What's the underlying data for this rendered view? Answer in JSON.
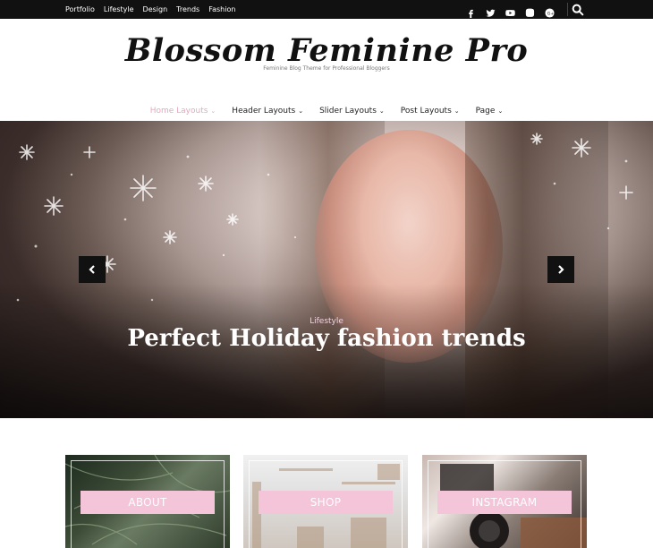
{
  "topbar": {
    "nav": [
      "Portfolio",
      "Lifestyle",
      "Design",
      "Trends",
      "Fashion"
    ],
    "social_icons": [
      "facebook-icon",
      "twitter-icon",
      "youtube-icon",
      "instagram-icon",
      "google-plus-icon"
    ],
    "search_icon": "search-icon"
  },
  "brand": {
    "title": "Blossom Feminine Pro",
    "tagline": "Feminine Blog Theme for Professional Bloggers"
  },
  "main_nav": [
    {
      "label": "Home Layouts",
      "active": true
    },
    {
      "label": "Header Layouts",
      "active": false
    },
    {
      "label": "Slider Layouts",
      "active": false
    },
    {
      "label": "Post Layouts",
      "active": false
    },
    {
      "label": "Page",
      "active": false
    }
  ],
  "hero": {
    "category": "Lifestyle",
    "title": "Perfect Holiday fashion trends"
  },
  "promo_cards": [
    {
      "label": "ABOUT"
    },
    {
      "label": "SHOP"
    },
    {
      "label": "INSTAGRAM"
    }
  ],
  "colors": {
    "accent_pink": "#f4c4d8",
    "active_nav": "#e7a6bf",
    "topbar_bg": "#111111"
  }
}
